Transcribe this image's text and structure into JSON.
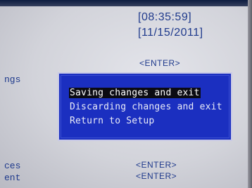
{
  "setup": {
    "time_value": "[08:35:59]",
    "date_value": "[11/15/2011]",
    "enter_labels": [
      "<ENTER>",
      "<ENTER>",
      "<ENTER>"
    ],
    "left_labels": [
      "ngs",
      "ces",
      "ent"
    ]
  },
  "dialog": {
    "items": [
      {
        "label": "Saving changes and exit",
        "selected": true
      },
      {
        "label": "Discarding changes and exit",
        "selected": false
      },
      {
        "label": "Return to Setup",
        "selected": false
      }
    ]
  },
  "colors": {
    "dialog_bg": "#1b2fc0",
    "value_text": "#1f3a8c",
    "highlight": "#0b0b12"
  }
}
